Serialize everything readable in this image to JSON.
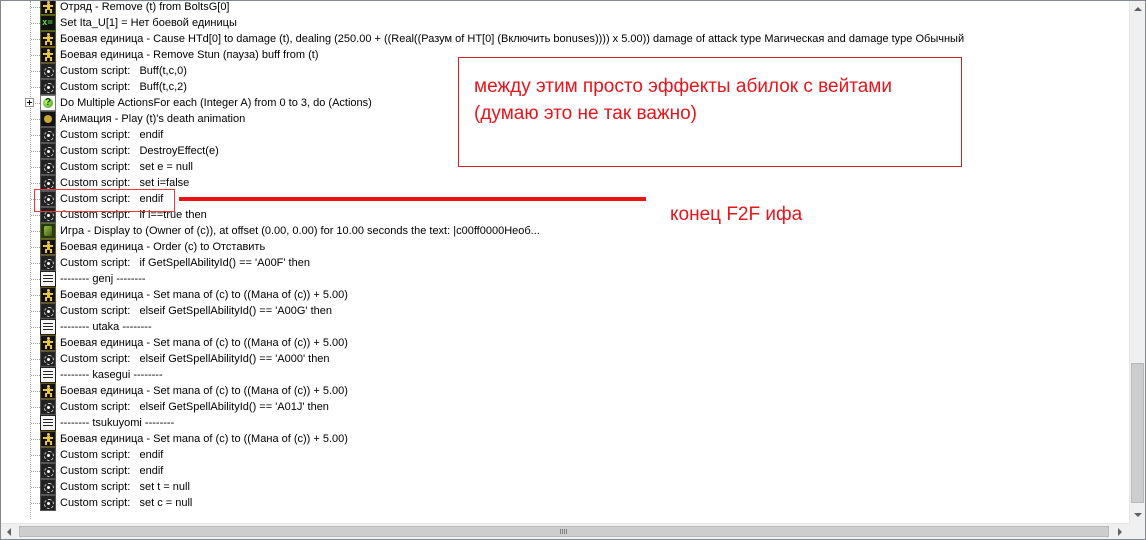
{
  "tree": {
    "rows": [
      {
        "icon": "unit-icon",
        "text": "Отряд - Remove (t) from BoltsG[0]"
      },
      {
        "icon": "set-variable-icon",
        "text": "Set Ita_U[1] = Нет боевой единицы"
      },
      {
        "icon": "unit-icon",
        "text": "Боевая единица - Cause HTd[0] to damage (t), dealing (250.00 + ((Real((Разум of HT[0] (Включить bonuses)))) x 5.00)) damage of attack type Магическая and damage type Обычный"
      },
      {
        "icon": "unit-icon",
        "text": "Боевая единица - Remove Stun (пауза) buff from (t)"
      },
      {
        "icon": "custom-script-icon",
        "text": "Custom script:   Buff(t,c,0)"
      },
      {
        "icon": "custom-script-icon",
        "text": "Custom script:   Buff(t,c,2)"
      },
      {
        "icon": "loop-icon",
        "text": "Do Multiple ActionsFor each (Integer A) from 0 to 3, do (Actions)",
        "expandable": true
      },
      {
        "icon": "animation-icon",
        "text": "Анимация - Play (t)'s death animation"
      },
      {
        "icon": "custom-script-icon",
        "text": "Custom script:   endif"
      },
      {
        "icon": "custom-script-icon",
        "text": "Custom script:   DestroyEffect(e)"
      },
      {
        "icon": "custom-script-icon",
        "text": "Custom script:   set e = null"
      },
      {
        "icon": "custom-script-icon",
        "text": "Custom script:   set i=false"
      },
      {
        "icon": "custom-script-icon",
        "text": "Custom script:   endif"
      },
      {
        "icon": "custom-script-icon",
        "text": "Custom script:   if i==true then"
      },
      {
        "icon": "game-icon",
        "text": "Игра - Display to (Owner of (c)), at offset (0.00, 0.00) for 10.00 seconds the text: |c00ff0000Необ..."
      },
      {
        "icon": "unit-icon",
        "text": "Боевая единица - Order (c) to Отставить"
      },
      {
        "icon": "custom-script-icon",
        "text": "Custom script:   if GetSpellAbilityId() == 'A00F' then"
      },
      {
        "icon": "comment-icon",
        "text": "-------- genj --------"
      },
      {
        "icon": "unit-icon",
        "text": "Боевая единица - Set mana of (c) to ((Мана of (c)) + 5.00)"
      },
      {
        "icon": "custom-script-icon",
        "text": "Custom script:   elseif GetSpellAbilityId() == 'A00G' then"
      },
      {
        "icon": "comment-icon",
        "text": "-------- utaka --------"
      },
      {
        "icon": "unit-icon",
        "text": "Боевая единица - Set mana of (c) to ((Мана of (c)) + 5.00)"
      },
      {
        "icon": "custom-script-icon",
        "text": "Custom script:   elseif GetSpellAbilityId() == 'A000' then"
      },
      {
        "icon": "comment-icon",
        "text": "-------- kasegui --------"
      },
      {
        "icon": "unit-icon",
        "text": "Боевая единица - Set mana of (c) to ((Мана of (c)) + 5.00)"
      },
      {
        "icon": "custom-script-icon",
        "text": "Custom script:   elseif GetSpellAbilityId() == 'A01J' then"
      },
      {
        "icon": "comment-icon",
        "text": "-------- tsukuyomi --------"
      },
      {
        "icon": "unit-icon",
        "text": "Боевая единица - Set mana of (c) to ((Мана of (c)) + 5.00)"
      },
      {
        "icon": "custom-script-icon",
        "text": "Custom script:   endif"
      },
      {
        "icon": "custom-script-icon",
        "text": "Custom script:   endif"
      },
      {
        "icon": "custom-script-icon",
        "text": "Custom script:   set t = null"
      },
      {
        "icon": "custom-script-icon",
        "text": "Custom script:   set c = null"
      }
    ]
  },
  "annotations": {
    "note": "между этим просто эффекты абилок с вейтами\n(думаю это не так важно)",
    "end_label": "конец F2F ифа",
    "color": "#e8141b"
  }
}
